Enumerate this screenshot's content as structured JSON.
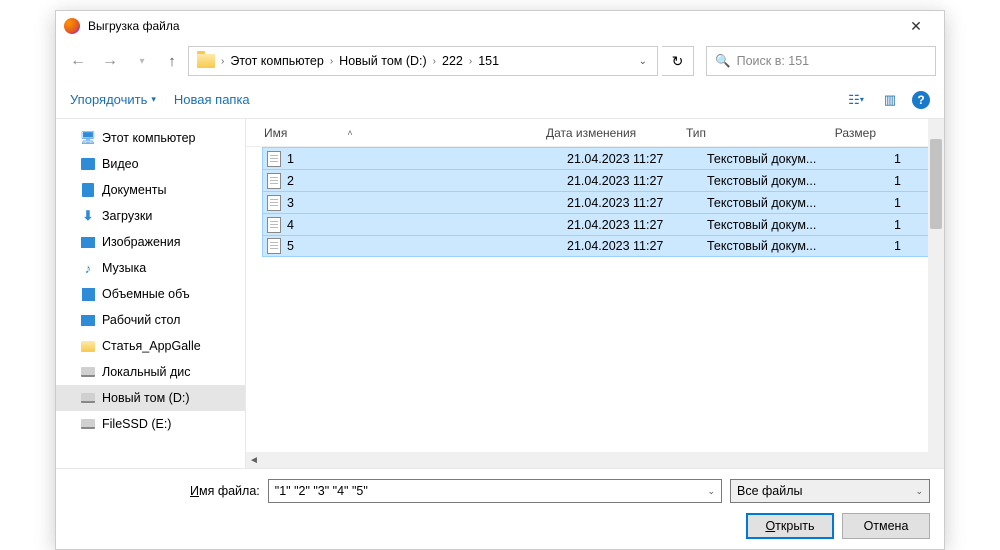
{
  "title": "Выгрузка файла",
  "breadcrumbs": [
    "Этот компьютер",
    "Новый том (D:)",
    "222",
    "151"
  ],
  "search_placeholder": "Поиск в: 151",
  "toolbar": {
    "organize": "Упорядочить",
    "new_folder": "Новая папка"
  },
  "tree": [
    {
      "label": "Этот компьютер",
      "icon": "pc"
    },
    {
      "label": "Видео",
      "icon": "vid"
    },
    {
      "label": "Документы",
      "icon": "doc"
    },
    {
      "label": "Загрузки",
      "icon": "dl"
    },
    {
      "label": "Изображения",
      "icon": "img"
    },
    {
      "label": "Музыка",
      "icon": "mus"
    },
    {
      "label": "Объемные объ",
      "icon": "3d"
    },
    {
      "label": "Рабочий стол",
      "icon": "desk"
    },
    {
      "label": "Статья_AppGalle",
      "icon": "fld"
    },
    {
      "label": "Локальный дис",
      "icon": "hdd"
    },
    {
      "label": "Новый том (D:)",
      "icon": "hdd"
    },
    {
      "label": "FileSSD (E:)",
      "icon": "hdd"
    }
  ],
  "columns": {
    "name": "Имя",
    "date": "Дата изменения",
    "type": "Тип",
    "size": "Размер"
  },
  "files": [
    {
      "name": "1",
      "date": "21.04.2023 11:27",
      "type": "Текстовый докум...",
      "size": "1"
    },
    {
      "name": "2",
      "date": "21.04.2023 11:27",
      "type": "Текстовый докум...",
      "size": "1"
    },
    {
      "name": "3",
      "date": "21.04.2023 11:27",
      "type": "Текстовый докум...",
      "size": "1"
    },
    {
      "name": "4",
      "date": "21.04.2023 11:27",
      "type": "Текстовый докум...",
      "size": "1"
    },
    {
      "name": "5",
      "date": "21.04.2023 11:27",
      "type": "Текстовый докум...",
      "size": "1"
    }
  ],
  "filename_label_pre": "И",
  "filename_label_post": "мя файла:",
  "filename_value": "\"1\" \"2\" \"3\" \"4\" \"5\"",
  "filter": "Все файлы",
  "open_btn_pre": "О",
  "open_btn_post": "ткрыть",
  "cancel_btn": "Отмена"
}
